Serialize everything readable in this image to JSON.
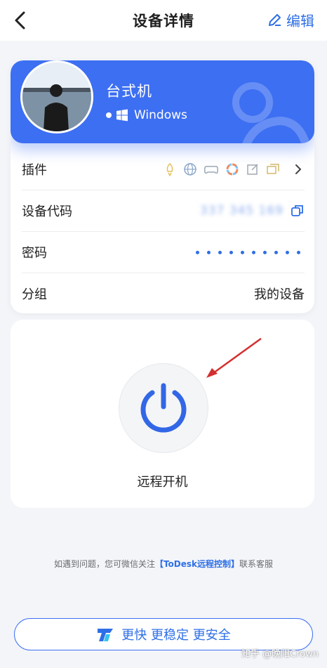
{
  "header": {
    "title": "设备详情",
    "edit_label": "编辑"
  },
  "device": {
    "name": "台式机",
    "os": "Windows"
  },
  "rows": {
    "plugins_label": "插件",
    "code_label": "设备代码",
    "code_value": "337 345 169",
    "password_label": "密码",
    "group_label": "分组",
    "group_value": "我的设备"
  },
  "power": {
    "label": "远程开机"
  },
  "help": {
    "prefix": "如遇到问题，您可微信关注",
    "brand": "【ToDesk远程控制】",
    "suffix": "联系客服"
  },
  "banner": {
    "text": "更快 更稳定 更安全"
  },
  "watermark": "知乎 @晚阳Crown",
  "colors": {
    "accent": "#3d6ff2",
    "link": "#2f6fe6",
    "arrow": "#d32f2f"
  },
  "icons": [
    "back-chevron-icon",
    "edit-pencil-icon",
    "windows-logo-icon",
    "rocket-icon",
    "globe-icon",
    "gamepad-icon",
    "color-wheel-icon",
    "edit-box-icon",
    "window-copy-icon",
    "chevron-right-icon",
    "copy-icon",
    "power-icon",
    "todesk-logo-icon"
  ]
}
